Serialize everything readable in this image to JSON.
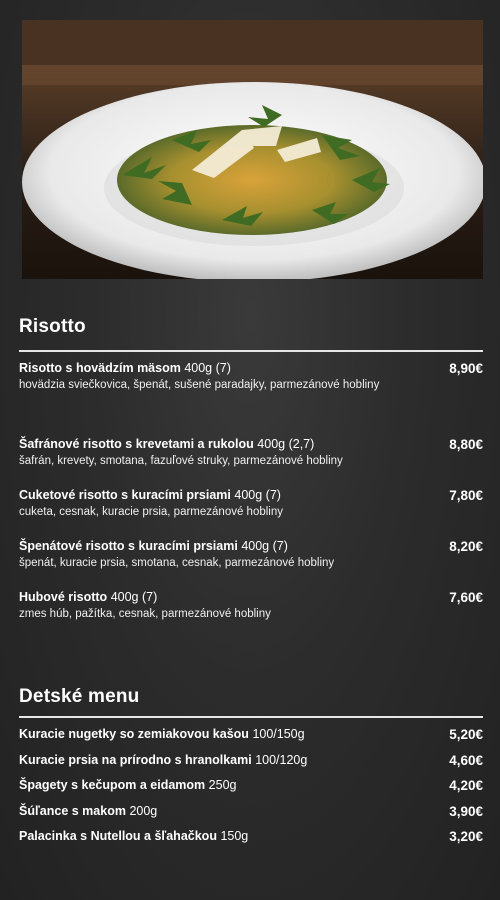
{
  "photo": {
    "icon": "risotto-dish-photo"
  },
  "sections": [
    {
      "title": "Risotto",
      "items": [
        {
          "name": "Risotto s hovädzím mäsom",
          "size": "400g (7)",
          "price": "8,90€",
          "desc": "hovädzia sviečkovica, špenát, sušené paradajky, parmezánové hobliny"
        },
        {
          "name": "Šafránové risotto s krevetami a rukolou",
          "size": "400g (2,7)",
          "price": "8,80€",
          "desc": "šafrán, krevety, smotana, fazuľové struky, parmezánové hobliny"
        },
        {
          "name": "Cuketové risotto s kuracími prsiami",
          "size": "400g (7)",
          "price": "7,80€",
          "desc": "cuketa, cesnak, kuracie prsia, parmezánové hobliny"
        },
        {
          "name": "Špenátové risotto s kuracími prsiami",
          "size": "400g (7)",
          "price": "8,20€",
          "desc": "špenát, kuracie prsia, smotana, cesnak, parmezánové hobliny"
        },
        {
          "name": "Hubové risotto",
          "size": "400g (7)",
          "price": "7,60€",
          "desc": "zmes húb, pažítka, cesnak, parmezánové hobliny"
        }
      ]
    },
    {
      "title": "Detské menu",
      "items": [
        {
          "name": "Kuracie nugetky so zemiakovou kašou",
          "size": "100/150g",
          "price": "5,20€"
        },
        {
          "name": "Kuracie prsia na prírodno s hranolkami",
          "size": "100/120g",
          "price": "4,60€"
        },
        {
          "name": "Špagety s kečupom a eidamom",
          "size": "250g",
          "price": "4,20€"
        },
        {
          "name": "Šúľance s makom",
          "size": "200g",
          "price": "3,90€"
        },
        {
          "name": "Palacinka s Nutellou a šľahačkou",
          "size": "150g",
          "price": "3,20€"
        }
      ]
    }
  ]
}
